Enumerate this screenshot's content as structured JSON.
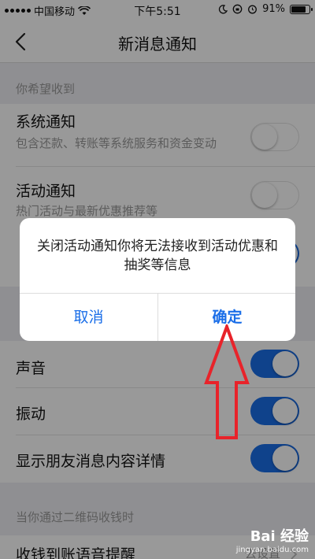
{
  "status_bar": {
    "carrier": "中国移动",
    "time": "下午5:51",
    "battery_pct": "91%",
    "battery_level": 0.91
  },
  "nav": {
    "title": "新消息通知",
    "back_icon": "chevron-left-icon"
  },
  "sections": {
    "receive_header": "你希望收到",
    "qr_header": "当你通过二维码收钱时"
  },
  "settings": {
    "system": {
      "title": "系统通知",
      "subtitle": "包含还款、转账等系统服务和资金变动",
      "enabled": false
    },
    "activity": {
      "title": "活动通知",
      "subtitle": "热门活动与最新优惠推荐等",
      "enabled": false
    },
    "sound": {
      "title": "声音",
      "enabled": true
    },
    "vibrate": {
      "title": "振动",
      "enabled": true
    },
    "show_detail": {
      "title": "显示朋友消息内容详情",
      "enabled": true
    },
    "voice_reminder": {
      "title": "收钱到账语音提醒",
      "value": "去设置"
    }
  },
  "dialog": {
    "message": "关闭活动通知你将无法接收到活动优惠和抽奖等信息",
    "cancel_label": "取消",
    "confirm_label": "确定"
  },
  "colors": {
    "accent": "#1a6ee8",
    "arrow": "#e8232a"
  },
  "watermark": {
    "logo": "Bai 经验",
    "url": "jingyan.baidu.com"
  }
}
